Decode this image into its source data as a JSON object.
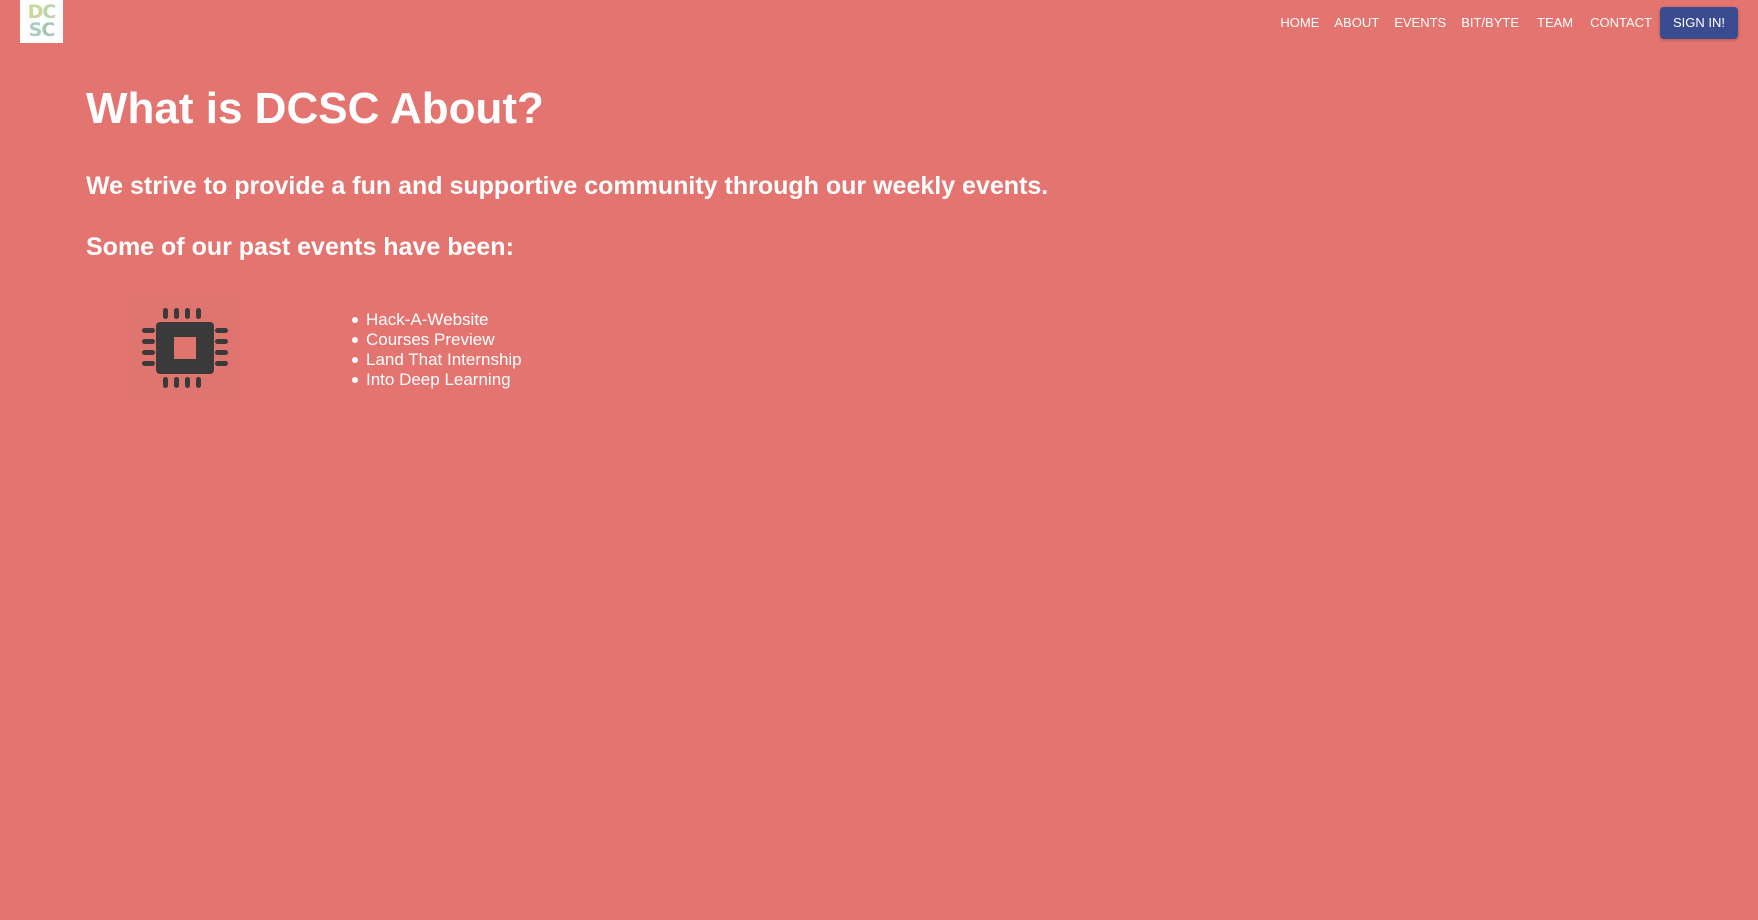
{
  "header": {
    "logo": {
      "line1": [
        "D",
        "C"
      ],
      "line2": [
        "S",
        "C"
      ],
      "colors": [
        "#c8d89a",
        "#b9d6a8",
        "#a8ccc0",
        "#a6c7b4"
      ]
    },
    "nav": {
      "items": [
        {
          "label": "HOME"
        },
        {
          "label": "ABOUT"
        },
        {
          "label": "EVENTS"
        },
        {
          "label": "BIT/BYTE"
        },
        {
          "label": "TEAM"
        },
        {
          "label": "CONTACT"
        }
      ],
      "signin_label": "SIGN IN!",
      "signin_color": "#3b4b8f"
    }
  },
  "main": {
    "title": "What is DCSC About?",
    "subtitle": "We strive to provide a fun and supportive community through our weekly events.",
    "past_heading": "Some of our past events have been:",
    "image_icon": "cpu-chip-icon",
    "events": [
      "Hack-A-Website",
      "Courses Preview",
      "Land That Internship",
      "Into Deep Learning"
    ]
  },
  "colors": {
    "background": "#e4746f",
    "text": "#ffffff",
    "icon": "#3a3a3a"
  }
}
